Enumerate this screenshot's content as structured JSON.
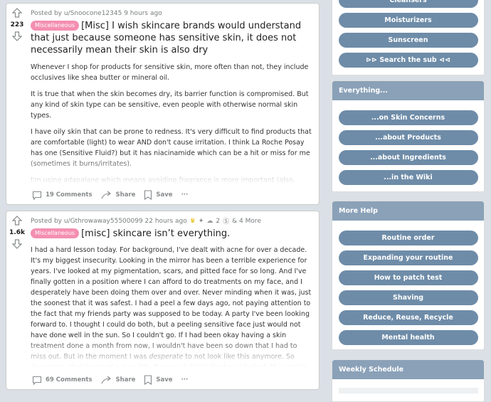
{
  "posts": [
    {
      "score": "223",
      "meta": "Posted by u/Snoocone12345 9 hours ago",
      "flair": "Miscellaneous",
      "title": "[Misc] I wish skincare brands would understand that just because someone has sensitive skin, it does not necessarily mean their skin is also dry",
      "paragraphs": [
        "Whenever I shop for products for sensitive skin, more often than not, they include occlusives like shea butter or mineral oil.",
        "It is true that when the skin becomes dry, its barrier function is compromised. But any kind of skin type can be sensitive, even people with otherwise normal skin types.",
        "I have oily skin that can be prone to redness. It's very difficult to find products that are comfortable (light) to wear AND don't cause irritation. I think La Roche Posay has one (Sensitive Fluid?) but it has niacinamide which can be a hit or miss for me (sometimes it burns/irritates).",
        "I'm using adapalane which means avoiding fragrance is more important (also, some fragrances can trigger migraines for me). Yet I'm tempted to purchase something with"
      ],
      "comments": "19 Comments",
      "share": "Share",
      "save": "Save"
    },
    {
      "score": "1.6k",
      "meta": "Posted by u/Gthrowaway55500099 22 hours ago",
      "awards": [
        "gold-award",
        "award",
        "award"
      ],
      "award_count": "2",
      "more_awards": "& 4 More",
      "flair": "Miscellaneous",
      "title": "[misc] skincare isn’t everything.",
      "body_before_em": "I had a hard lesson today. For background, I've dealt with acne for over a decade. It's my biggest insecurity. Looking in the mirror has been a terrible experience for years. I've looked at my pigmentation, scars, and pitted face for so long. And I've finally gotten in a position where I can afford to do treatments on my face, and I desperately have been doing them over and over. Never minding when it was, just the soonest that it was safest. I had a peel a few days ago, not paying attention to the fact that my friends party was supposed to be today. A party I've been looking forward to. I thought I could do both, but a peeling sensitive face just would not have done well in the sun. So I couldn't go. If I had been okay having a skin treatment done a month from now, I wouldn't have been so down that I had to miss out. But in the moment I was ",
      "body_em": "desperate",
      "body_after_em": " to not look like this anymore. So desperate, that I missed out on life. Because I didn't like how I looked. My point is that your skincare is important, but don't let it interfere with living your life. I",
      "comments": "69 Comments",
      "share": "Share",
      "save": "Save"
    }
  ],
  "sidebar": {
    "top_buttons": [
      "Cleansers",
      "Moisturizers",
      "Sunscreen",
      "⊳⊳ Search the sub ⊲⊲"
    ],
    "everything": {
      "title": "Everything...",
      "buttons": [
        "...on Skin Concerns",
        "...about Products",
        "...about Ingredients",
        "...in the Wiki"
      ]
    },
    "more_help": {
      "title": "More Help",
      "buttons": [
        "Routine order",
        "Expanding your routine",
        "How to patch test",
        "Shaving",
        "Reduce, Reuse, Recycle",
        "Mental health"
      ]
    },
    "weekly": {
      "title": "Weekly Schedule"
    }
  },
  "colors": {
    "flair": "#f48fb1",
    "sidebar_button": "#6e8ca8",
    "widget_header": "#8aa1b8"
  }
}
